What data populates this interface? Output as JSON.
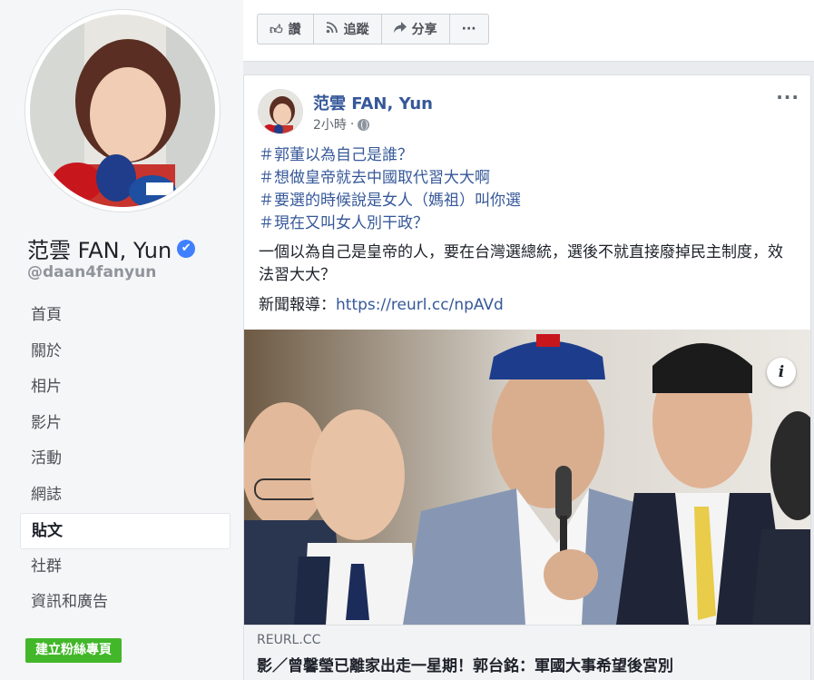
{
  "profile": {
    "name": "范雲 FAN, Yun",
    "handle": "@daan4fanyun",
    "verified_icon": "✔"
  },
  "nav": {
    "items": [
      {
        "label": "首頁"
      },
      {
        "label": "關於"
      },
      {
        "label": "相片"
      },
      {
        "label": "影片"
      },
      {
        "label": "活動"
      },
      {
        "label": "網誌"
      },
      {
        "label": "貼文"
      },
      {
        "label": "社群"
      },
      {
        "label": "資訊和廣告"
      }
    ],
    "active": "貼文"
  },
  "create_page_label": "建立粉絲專頁",
  "actionbar": {
    "like": "讚",
    "follow": "追蹤",
    "share": "分享",
    "more": "···"
  },
  "post": {
    "author": "范雲 FAN, Yun",
    "time": "2小時",
    "more": "···",
    "hashtags": [
      "＃郭董以為自己是誰？",
      "＃想做皇帝就去中國取代習大大啊",
      "＃要選的時候說是女人（媽祖）叫你選",
      "＃現在又叫女人別干政？"
    ],
    "paragraph": "一個以為自己是皇帝的人，要在台灣選總統，選後不就直接廢掉民主制度，效法習大大？",
    "news_prefix": "新聞報導：",
    "news_link": "https://reurl.cc/npAVd",
    "info_icon": "i",
    "link_domain": "REURL.CC",
    "link_title": "影／曾馨瑩已離家出走一星期！郭台銘：軍國大事希望後宮別"
  },
  "colors": {
    "link_blue": "#365899",
    "green_button": "#42b72a",
    "background": "#e9ebee"
  }
}
